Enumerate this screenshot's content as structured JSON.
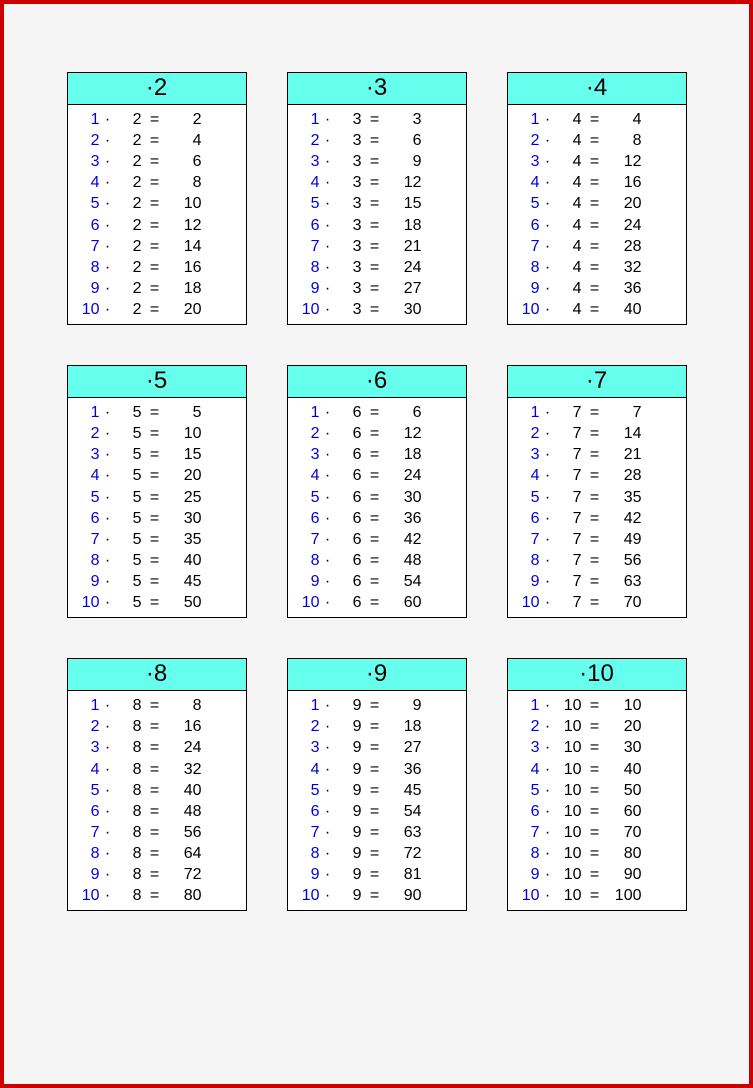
{
  "op": "·",
  "eq": "=",
  "watermark": "",
  "tables": [
    {
      "header": "·2",
      "rows": [
        {
          "a": "1",
          "b": "2",
          "r": "2"
        },
        {
          "a": "2",
          "b": "2",
          "r": "4"
        },
        {
          "a": "3",
          "b": "2",
          "r": "6"
        },
        {
          "a": "4",
          "b": "2",
          "r": "8"
        },
        {
          "a": "5",
          "b": "2",
          "r": "10"
        },
        {
          "a": "6",
          "b": "2",
          "r": "12"
        },
        {
          "a": "7",
          "b": "2",
          "r": "14"
        },
        {
          "a": "8",
          "b": "2",
          "r": "16"
        },
        {
          "a": "9",
          "b": "2",
          "r": "18"
        },
        {
          "a": "10",
          "b": "2",
          "r": "20"
        }
      ]
    },
    {
      "header": "·3",
      "rows": [
        {
          "a": "1",
          "b": "3",
          "r": "3"
        },
        {
          "a": "2",
          "b": "3",
          "r": "6"
        },
        {
          "a": "3",
          "b": "3",
          "r": "9"
        },
        {
          "a": "4",
          "b": "3",
          "r": "12"
        },
        {
          "a": "5",
          "b": "3",
          "r": "15"
        },
        {
          "a": "6",
          "b": "3",
          "r": "18"
        },
        {
          "a": "7",
          "b": "3",
          "r": "21"
        },
        {
          "a": "8",
          "b": "3",
          "r": "24"
        },
        {
          "a": "9",
          "b": "3",
          "r": "27"
        },
        {
          "a": "10",
          "b": "3",
          "r": "30"
        }
      ]
    },
    {
      "header": "·4",
      "rows": [
        {
          "a": "1",
          "b": "4",
          "r": "4"
        },
        {
          "a": "2",
          "b": "4",
          "r": "8"
        },
        {
          "a": "3",
          "b": "4",
          "r": "12"
        },
        {
          "a": "4",
          "b": "4",
          "r": "16"
        },
        {
          "a": "5",
          "b": "4",
          "r": "20"
        },
        {
          "a": "6",
          "b": "4",
          "r": "24"
        },
        {
          "a": "7",
          "b": "4",
          "r": "28"
        },
        {
          "a": "8",
          "b": "4",
          "r": "32"
        },
        {
          "a": "9",
          "b": "4",
          "r": "36"
        },
        {
          "a": "10",
          "b": "4",
          "r": "40"
        }
      ]
    },
    {
      "header": "·5",
      "rows": [
        {
          "a": "1",
          "b": "5",
          "r": "5"
        },
        {
          "a": "2",
          "b": "5",
          "r": "10"
        },
        {
          "a": "3",
          "b": "5",
          "r": "15"
        },
        {
          "a": "4",
          "b": "5",
          "r": "20"
        },
        {
          "a": "5",
          "b": "5",
          "r": "25"
        },
        {
          "a": "6",
          "b": "5",
          "r": "30"
        },
        {
          "a": "7",
          "b": "5",
          "r": "35"
        },
        {
          "a": "8",
          "b": "5",
          "r": "40"
        },
        {
          "a": "9",
          "b": "5",
          "r": "45"
        },
        {
          "a": "10",
          "b": "5",
          "r": "50"
        }
      ]
    },
    {
      "header": "·6",
      "rows": [
        {
          "a": "1",
          "b": "6",
          "r": "6"
        },
        {
          "a": "2",
          "b": "6",
          "r": "12"
        },
        {
          "a": "3",
          "b": "6",
          "r": "18"
        },
        {
          "a": "4",
          "b": "6",
          "r": "24"
        },
        {
          "a": "5",
          "b": "6",
          "r": "30"
        },
        {
          "a": "6",
          "b": "6",
          "r": "36"
        },
        {
          "a": "7",
          "b": "6",
          "r": "42"
        },
        {
          "a": "8",
          "b": "6",
          "r": "48"
        },
        {
          "a": "9",
          "b": "6",
          "r": "54"
        },
        {
          "a": "10",
          "b": "6",
          "r": "60"
        }
      ]
    },
    {
      "header": "·7",
      "rows": [
        {
          "a": "1",
          "b": "7",
          "r": "7"
        },
        {
          "a": "2",
          "b": "7",
          "r": "14"
        },
        {
          "a": "3",
          "b": "7",
          "r": "21"
        },
        {
          "a": "4",
          "b": "7",
          "r": "28"
        },
        {
          "a": "5",
          "b": "7",
          "r": "35"
        },
        {
          "a": "6",
          "b": "7",
          "r": "42"
        },
        {
          "a": "7",
          "b": "7",
          "r": "49"
        },
        {
          "a": "8",
          "b": "7",
          "r": "56"
        },
        {
          "a": "9",
          "b": "7",
          "r": "63"
        },
        {
          "a": "10",
          "b": "7",
          "r": "70"
        }
      ]
    },
    {
      "header": "·8",
      "rows": [
        {
          "a": "1",
          "b": "8",
          "r": "8"
        },
        {
          "a": "2",
          "b": "8",
          "r": "16"
        },
        {
          "a": "3",
          "b": "8",
          "r": "24"
        },
        {
          "a": "4",
          "b": "8",
          "r": "32"
        },
        {
          "a": "5",
          "b": "8",
          "r": "40"
        },
        {
          "a": "6",
          "b": "8",
          "r": "48"
        },
        {
          "a": "7",
          "b": "8",
          "r": "56"
        },
        {
          "a": "8",
          "b": "8",
          "r": "64"
        },
        {
          "a": "9",
          "b": "8",
          "r": "72"
        },
        {
          "a": "10",
          "b": "8",
          "r": "80"
        }
      ]
    },
    {
      "header": "·9",
      "rows": [
        {
          "a": "1",
          "b": "9",
          "r": "9"
        },
        {
          "a": "2",
          "b": "9",
          "r": "18"
        },
        {
          "a": "3",
          "b": "9",
          "r": "27"
        },
        {
          "a": "4",
          "b": "9",
          "r": "36"
        },
        {
          "a": "5",
          "b": "9",
          "r": "45"
        },
        {
          "a": "6",
          "b": "9",
          "r": "54"
        },
        {
          "a": "7",
          "b": "9",
          "r": "63"
        },
        {
          "a": "8",
          "b": "9",
          "r": "72"
        },
        {
          "a": "9",
          "b": "9",
          "r": "81"
        },
        {
          "a": "10",
          "b": "9",
          "r": "90"
        }
      ]
    },
    {
      "header": "·10",
      "rows": [
        {
          "a": "1",
          "b": "10",
          "r": "10"
        },
        {
          "a": "2",
          "b": "10",
          "r": "20"
        },
        {
          "a": "3",
          "b": "10",
          "r": "30"
        },
        {
          "a": "4",
          "b": "10",
          "r": "40"
        },
        {
          "a": "5",
          "b": "10",
          "r": "50"
        },
        {
          "a": "6",
          "b": "10",
          "r": "60"
        },
        {
          "a": "7",
          "b": "10",
          "r": "70"
        },
        {
          "a": "8",
          "b": "10",
          "r": "80"
        },
        {
          "a": "9",
          "b": "10",
          "r": "90"
        },
        {
          "a": "10",
          "b": "10",
          "r": "100"
        }
      ]
    }
  ]
}
